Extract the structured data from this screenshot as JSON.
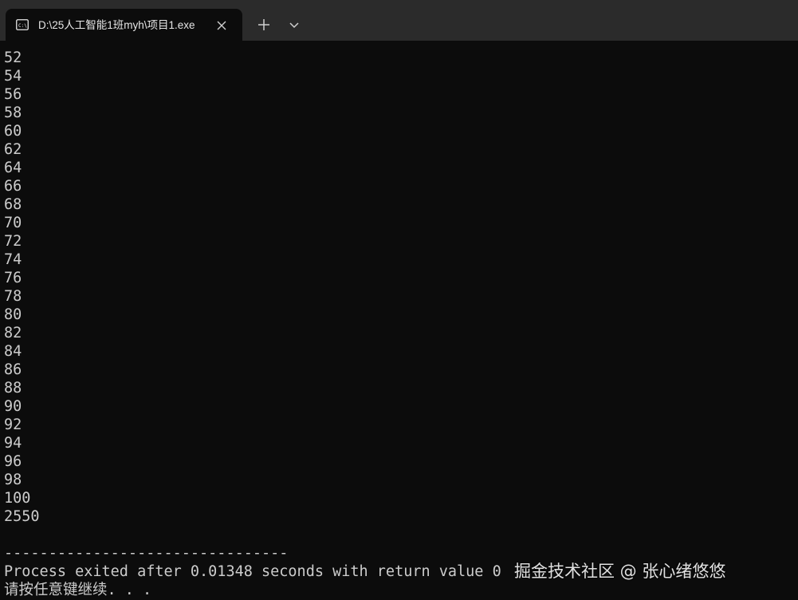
{
  "window": {
    "tab_title": "D:\\25人工智能1班myh\\项目1.exe",
    "tab_icon": "console-icon",
    "close_icon": "close-icon",
    "new_tab_icon": "plus-icon",
    "dropdown_icon": "chevron-down-icon"
  },
  "console": {
    "lines": [
      "52",
      "54",
      "56",
      "58",
      "60",
      "62",
      "64",
      "66",
      "68",
      "70",
      "72",
      "74",
      "76",
      "78",
      "80",
      "82",
      "84",
      "86",
      "88",
      "90",
      "92",
      "94",
      "96",
      "98",
      "100",
      "2550",
      "",
      "--------------------------------",
      "Process exited after 0.01348 seconds with return value 0",
      "请按任意键继续. . ."
    ]
  },
  "watermark": {
    "text": "掘金技术社区 @ 张心绪悠悠"
  },
  "colors": {
    "background": "#0c0c0c",
    "titlebar": "#2b2b2b",
    "text": "#cccccc"
  }
}
